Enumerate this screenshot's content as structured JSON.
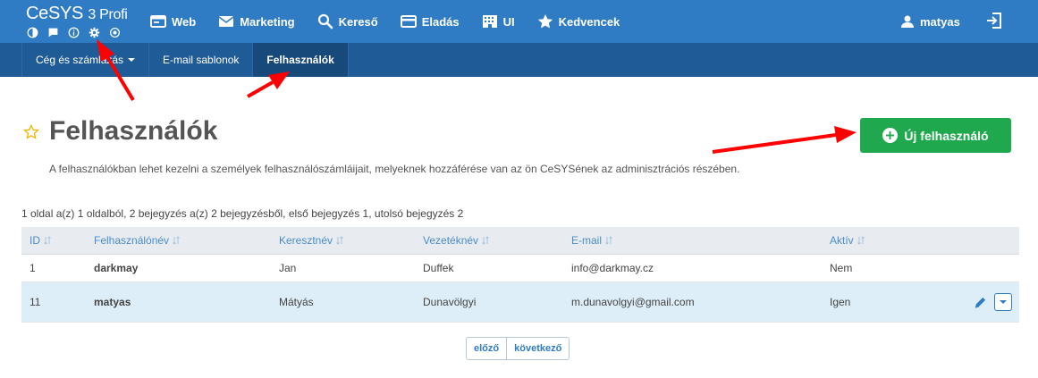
{
  "app": {
    "brand_main": "CeSYS",
    "brand_suffix": "3 Profi",
    "brand_icons": [
      "contrast-icon",
      "chat-icon",
      "info-icon",
      "settings-icon",
      "target-icon"
    ]
  },
  "nav": {
    "items": [
      {
        "label": "Web",
        "icon": "browser-window-icon"
      },
      {
        "label": "Marketing",
        "icon": "envelope-icon"
      },
      {
        "label": "Kereső",
        "icon": "search-icon"
      },
      {
        "label": "Eladás",
        "icon": "credit-card-icon"
      },
      {
        "label": "UI",
        "icon": "building-icon"
      },
      {
        "label": "Kedvencek",
        "icon": "star-icon"
      }
    ],
    "user_label": "matyas"
  },
  "subnav": {
    "items": [
      {
        "label": "Cég és számlázás",
        "dropdown": true
      },
      {
        "label": "E-mail sablonok",
        "dropdown": false
      },
      {
        "label": "Felhasználók",
        "dropdown": false,
        "active": true
      }
    ]
  },
  "page": {
    "title": "Felhasználók",
    "description": "A felhasználókban lehet kezelni a személyek felhasználószámláijait, melyeknek hozzáférése van az ön CeSYSének az adminisztrációs részében.",
    "new_button_label": "Új felhasználó",
    "paging_info": "1 oldal a(z) 1 oldalból, 2 bejegyzés a(z) 2 bejegyzésből, első bejegyzés 1, utolsó bejegyzés 2"
  },
  "table": {
    "columns": [
      "ID",
      "Felhasználónév",
      "Keresztnév",
      "Vezetéknév",
      "E-mail",
      "Aktív"
    ],
    "rows": [
      {
        "id": "1",
        "username": "darkmay",
        "first_name": "Jan",
        "last_name": "Duffek",
        "email": "info@darkmay.cz",
        "active": "Nem"
      },
      {
        "id": "11",
        "username": "matyas",
        "first_name": "Mátyás",
        "last_name": "Dunavölgyi",
        "email": "m.dunavolgyi@gmail.com",
        "active": "Igen"
      }
    ]
  },
  "pager": {
    "prev_label": "előző",
    "next_label": "következő"
  },
  "colors": {
    "topbar": "#2f7cc4",
    "subnav": "#1f5b96",
    "accent_green": "#1fa84e",
    "annotation_arrow": "#ff0000",
    "selected_row": "#deeef8"
  }
}
